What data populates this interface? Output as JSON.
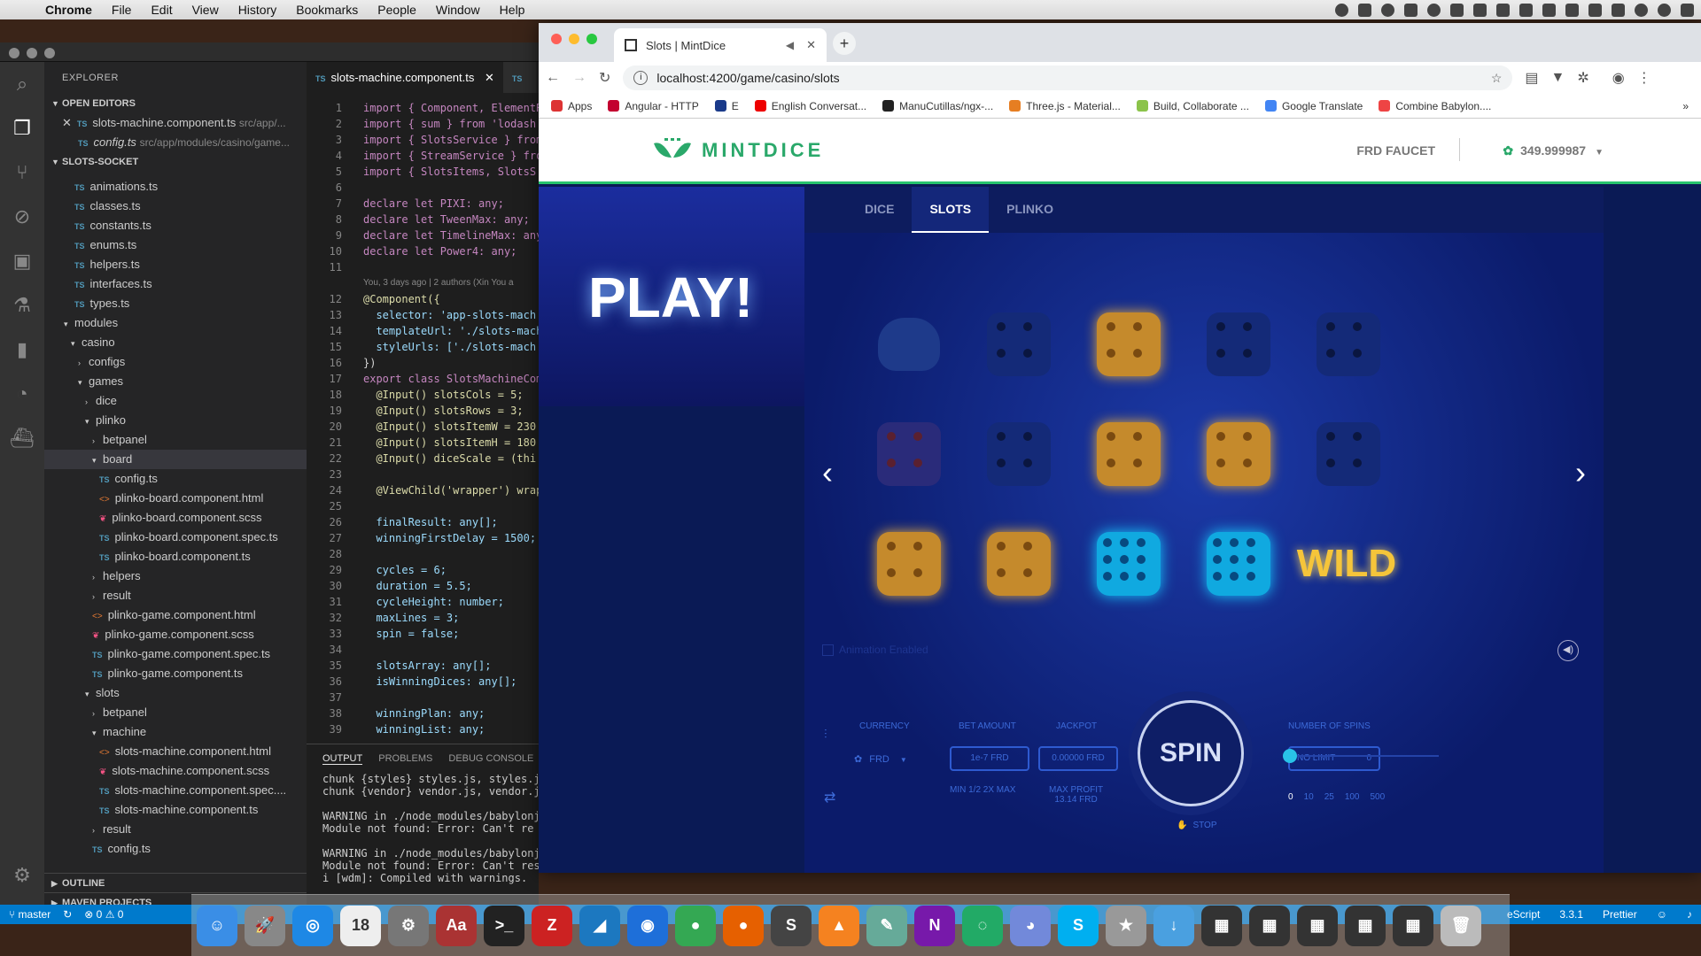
{
  "menubar": {
    "apple": "",
    "items": [
      "Chrome",
      "File",
      "Edit",
      "View",
      "History",
      "Bookmarks",
      "People",
      "Window",
      "Help"
    ]
  },
  "vscode": {
    "explorer_title": "EXPLORER",
    "open_editors_label": "OPEN EDITORS",
    "open_editors": [
      {
        "name": "slots-machine.component.ts",
        "path": "src/app/..."
      },
      {
        "name": "config.ts",
        "path": "src/app/modules/casino/game..."
      }
    ],
    "project_label": "SLOTS-SOCKET",
    "tree": [
      {
        "type": "ts",
        "label": "animations.ts",
        "indent": 34
      },
      {
        "type": "ts",
        "label": "classes.ts",
        "indent": 34
      },
      {
        "type": "ts",
        "label": "constants.ts",
        "indent": 34
      },
      {
        "type": "ts",
        "label": "enums.ts",
        "indent": 34
      },
      {
        "type": "ts",
        "label": "helpers.ts",
        "indent": 34
      },
      {
        "type": "ts",
        "label": "interfaces.ts",
        "indent": 34
      },
      {
        "type": "ts",
        "label": "types.ts",
        "indent": 34
      },
      {
        "type": "folder-open",
        "label": "modules",
        "indent": 22
      },
      {
        "type": "folder-open",
        "label": "casino",
        "indent": 30
      },
      {
        "type": "folder",
        "label": "configs",
        "indent": 38
      },
      {
        "type": "folder-open",
        "label": "games",
        "indent": 38
      },
      {
        "type": "folder",
        "label": "dice",
        "indent": 46
      },
      {
        "type": "folder-open",
        "label": "plinko",
        "indent": 46
      },
      {
        "type": "folder",
        "label": "betpanel",
        "indent": 54
      },
      {
        "type": "folder-open",
        "label": "board",
        "indent": 54,
        "selected": true
      },
      {
        "type": "ts",
        "label": "config.ts",
        "indent": 62
      },
      {
        "type": "html",
        "label": "plinko-board.component.html",
        "indent": 62
      },
      {
        "type": "scss",
        "label": "plinko-board.component.scss",
        "indent": 62
      },
      {
        "type": "ts",
        "label": "plinko-board.component.spec.ts",
        "indent": 62
      },
      {
        "type": "ts",
        "label": "plinko-board.component.ts",
        "indent": 62
      },
      {
        "type": "folder",
        "label": "helpers",
        "indent": 54
      },
      {
        "type": "folder",
        "label": "result",
        "indent": 54
      },
      {
        "type": "html",
        "label": "plinko-game.component.html",
        "indent": 54
      },
      {
        "type": "scss",
        "label": "plinko-game.component.scss",
        "indent": 54
      },
      {
        "type": "ts",
        "label": "plinko-game.component.spec.ts",
        "indent": 54
      },
      {
        "type": "ts",
        "label": "plinko-game.component.ts",
        "indent": 54
      },
      {
        "type": "folder-open",
        "label": "slots",
        "indent": 46
      },
      {
        "type": "folder",
        "label": "betpanel",
        "indent": 54
      },
      {
        "type": "folder-open",
        "label": "machine",
        "indent": 54
      },
      {
        "type": "html",
        "label": "slots-machine.component.html",
        "indent": 62
      },
      {
        "type": "scss",
        "label": "slots-machine.component.scss",
        "indent": 62
      },
      {
        "type": "ts",
        "label": "slots-machine.component.spec....",
        "indent": 62
      },
      {
        "type": "ts",
        "label": "slots-machine.component.ts",
        "indent": 62
      },
      {
        "type": "folder",
        "label": "result",
        "indent": 54
      },
      {
        "type": "ts",
        "label": "config.ts",
        "indent": 54
      }
    ],
    "outline_label": "OUTLINE",
    "maven_label": "MAVEN PROJECTS",
    "editor_tabs": [
      "slots-machine.component.ts",
      "TS"
    ],
    "blame_1": "You, 3 days ago | 2 authors (Xin You a",
    "blame_2": "You, 3 days ago | 2 authors (Xin You a",
    "code": [
      {
        "n": "1",
        "t": "import { Component, ElementR"
      },
      {
        "n": "2",
        "t": "import { sum } from 'lodash"
      },
      {
        "n": "3",
        "t": "import { SlotsService } from"
      },
      {
        "n": "4",
        "t": "import { StreamService } fro"
      },
      {
        "n": "5",
        "t": "import { SlotsItems, SlotsS"
      },
      {
        "n": "6",
        "t": ""
      },
      {
        "n": "7",
        "t": "declare let PIXI: any;"
      },
      {
        "n": "8",
        "t": "declare let TweenMax: any;"
      },
      {
        "n": "9",
        "t": "declare let TimelineMax: any"
      },
      {
        "n": "10",
        "t": "declare let Power4: any;"
      },
      {
        "n": "11",
        "t": ""
      },
      {
        "n": "12",
        "t": "@Component({"
      },
      {
        "n": "13",
        "t": "  selector: 'app-slots-mach"
      },
      {
        "n": "14",
        "t": "  templateUrl: './slots-mach"
      },
      {
        "n": "15",
        "t": "  styleUrls: ['./slots-mach"
      },
      {
        "n": "16",
        "t": "})"
      },
      {
        "n": "17",
        "t": "export class SlotsMachineCom"
      },
      {
        "n": "18",
        "t": "  @Input() slotsCols = 5;"
      },
      {
        "n": "19",
        "t": "  @Input() slotsRows = 3;"
      },
      {
        "n": "20",
        "t": "  @Input() slotsItemW = 230"
      },
      {
        "n": "21",
        "t": "  @Input() slotsItemH = 180"
      },
      {
        "n": "22",
        "t": "  @Input() diceScale = (thi"
      },
      {
        "n": "23",
        "t": ""
      },
      {
        "n": "24",
        "t": "  @ViewChild('wrapper') wrap"
      },
      {
        "n": "25",
        "t": ""
      },
      {
        "n": "26",
        "t": "  finalResult: any[];"
      },
      {
        "n": "27",
        "t": "  winningFirstDelay = 1500;"
      },
      {
        "n": "28",
        "t": ""
      },
      {
        "n": "29",
        "t": "  cycles = 6;"
      },
      {
        "n": "30",
        "t": "  duration = 5.5;"
      },
      {
        "n": "31",
        "t": "  cycleHeight: number;"
      },
      {
        "n": "32",
        "t": "  maxLines = 3;"
      },
      {
        "n": "33",
        "t": "  spin = false;"
      },
      {
        "n": "34",
        "t": ""
      },
      {
        "n": "35",
        "t": "  slotsArray: any[];"
      },
      {
        "n": "36",
        "t": "  isWinningDices: any[];"
      },
      {
        "n": "37",
        "t": ""
      },
      {
        "n": "38",
        "t": "  winningPlan: any;"
      },
      {
        "n": "39",
        "t": "  winningList: any;"
      }
    ],
    "panel_tabs": [
      "OUTPUT",
      "PROBLEMS",
      "DEBUG CONSOLE"
    ],
    "terminal": [
      {
        "t": "chunk {styles} styles.js, styles.js",
        "c": ""
      },
      {
        "t": "chunk {vendor} vendor.js, vendor.js",
        "c": ""
      },
      {
        "t": "",
        "c": ""
      },
      {
        "t": "WARNING in ./node_modules/babylonjs",
        "c": "warn"
      },
      {
        "t": "Module not found: Error: Can't re",
        "c": "warn"
      },
      {
        "t": "",
        "c": ""
      },
      {
        "t": "WARNING in ./node_modules/babylonjs",
        "c": "warn"
      },
      {
        "t": "Module not found: Error: Can't reso",
        "c": "warn"
      },
      {
        "t": "i [wdm]: Compiled with warnings.",
        "c": ""
      }
    ]
  },
  "statusbar": {
    "branch": "master",
    "problems": "⊗ 0 ⚠ 0",
    "right": [
      "eScript",
      "3.3.1",
      "Prettier"
    ]
  },
  "chrome": {
    "tab_title": "Slots | MintDice",
    "url": "localhost:4200/game/casino/slots",
    "bookmarks": [
      {
        "label": "Apps",
        "color": "#d33"
      },
      {
        "label": "Angular - HTTP",
        "color": "#c3002f"
      },
      {
        "label": "E",
        "color": "#1a3a8a"
      },
      {
        "label": "English Conversat...",
        "color": "#e00"
      },
      {
        "label": "ManuCutillas/ngx-...",
        "color": "#222"
      },
      {
        "label": "Three.js - Material...",
        "color": "#e67e22"
      },
      {
        "label": "Build, Collaborate ...",
        "color": "#8bc34a"
      },
      {
        "label": "Google Translate",
        "color": "#4285f4"
      },
      {
        "label": "Combine Babylon....",
        "color": "#e44"
      }
    ]
  },
  "site": {
    "logo": "MINTDICE",
    "faucet": "FRD FAUCET",
    "balance": "349.999987",
    "play": "PLAY!",
    "tabs": [
      "DICE",
      "SLOTS",
      "PLINKO"
    ],
    "active_tab": "SLOTS",
    "reels": [
      [
        "ghost",
        "dim",
        "gold",
        "dim",
        "dim"
      ],
      [
        "red",
        "dim",
        "gold",
        "gold",
        "dim"
      ],
      [
        "gold",
        "gold",
        "cyan",
        "cyan",
        "wild"
      ]
    ],
    "wild_label": "WILD",
    "animation_label": "Animation Enabled",
    "currency_label": "CURRENCY",
    "currency_value": "FRD",
    "bet_label": "BET AMOUNT",
    "bet_value": "1e-7 FRD",
    "bet_opts": "MIN 1/2 2X MAX",
    "jackpot_label": "JACKPOT",
    "jackpot_value": "0.00000 FRD",
    "maxprofit_label": "MAX PROFIT",
    "maxprofit_value": "13.14 FRD",
    "spin": "SPIN",
    "stop": "STOP",
    "spins_label": "NUMBER OF SPINS",
    "spins_value": "NO LIMIT",
    "spins_count": "0",
    "spin_chips": [
      "0",
      "10",
      "25",
      "100",
      "500"
    ]
  },
  "dock": [
    {
      "name": "finder",
      "color": "#3a8ee6",
      "glyph": "☺"
    },
    {
      "name": "launchpad",
      "color": "#888",
      "glyph": "🚀"
    },
    {
      "name": "safari",
      "color": "#1e88e5",
      "glyph": "◎"
    },
    {
      "name": "calendar",
      "color": "#eee",
      "glyph": "18"
    },
    {
      "name": "system-preferences",
      "color": "#777",
      "glyph": "⚙"
    },
    {
      "name": "dictionary",
      "color": "#a33",
      "glyph": "Aa"
    },
    {
      "name": "terminal",
      "color": "#222",
      "glyph": ">_"
    },
    {
      "name": "filezilla",
      "color": "#c22",
      "glyph": "Z"
    },
    {
      "name": "vscode",
      "color": "#1c78c0",
      "glyph": "◢"
    },
    {
      "name": "maps",
      "color": "#1e6fd9",
      "glyph": "◉"
    },
    {
      "name": "chrome",
      "color": "#34a853",
      "glyph": "●"
    },
    {
      "name": "firefox",
      "color": "#e66000",
      "glyph": "●"
    },
    {
      "name": "scrivener",
      "color": "#444",
      "glyph": "S"
    },
    {
      "name": "vlc",
      "color": "#f58220",
      "glyph": "▲"
    },
    {
      "name": "preview",
      "color": "#6a9",
      "glyph": "✎"
    },
    {
      "name": "onenote",
      "color": "#7719aa",
      "glyph": "N"
    },
    {
      "name": "sourcetree",
      "color": "#2a6",
      "glyph": "◌"
    },
    {
      "name": "discord",
      "color": "#7289da",
      "glyph": "◕"
    },
    {
      "name": "skype",
      "color": "#00aff0",
      "glyph": "S"
    },
    {
      "name": "app-star",
      "color": "#999",
      "glyph": "★"
    },
    {
      "name": "downloads",
      "color": "#4aa0e0",
      "glyph": "↓"
    },
    {
      "name": "window-1",
      "color": "#333",
      "glyph": "▦"
    },
    {
      "name": "window-2",
      "color": "#333",
      "glyph": "▦"
    },
    {
      "name": "window-3",
      "color": "#333",
      "glyph": "▦"
    },
    {
      "name": "window-4",
      "color": "#333",
      "glyph": "▦"
    },
    {
      "name": "window-5",
      "color": "#333",
      "glyph": "▦"
    },
    {
      "name": "trash",
      "color": "#bbb",
      "glyph": "🗑"
    }
  ]
}
